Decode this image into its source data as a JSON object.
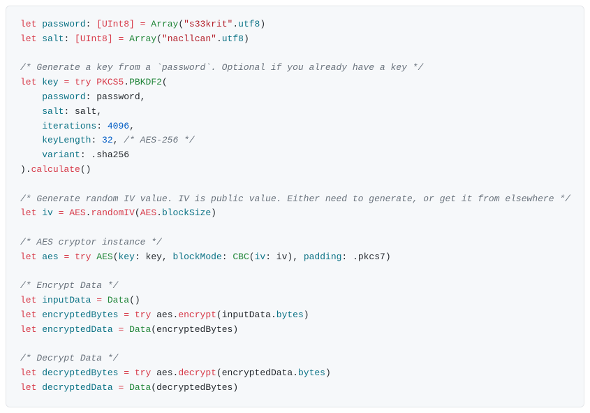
{
  "code": {
    "l1_let": "let",
    "l1_password": "password",
    "l1_type": "[UInt8]",
    "l1_array": "Array",
    "l1_str": "\"s33krit\"",
    "l1_utf8": "utf8",
    "l2_let": "let",
    "l2_salt": "salt",
    "l2_type": "[UInt8]",
    "l2_array": "Array",
    "l2_str": "\"nacllcan\"",
    "l2_utf8": "utf8",
    "c1": "/* Generate a key from a `password`. Optional if you already have a key */",
    "l3_let": "let",
    "l3_key": "key",
    "l3_try": "try",
    "l3_pkcs5": "PKCS5",
    "l3_pbkdf2": "PBKDF2",
    "l4_password_lbl": "password",
    "l4_password_val": "password",
    "l5_salt_lbl": "salt",
    "l5_salt_val": "salt",
    "l6_iter_lbl": "iterations",
    "l6_iter_val": "4096",
    "l7_keylen_lbl": "keyLength",
    "l7_keylen_val": "32",
    "l7_cm": "/* AES-256 */",
    "l8_variant_lbl": "variant",
    "l8_variant_val": "sha256",
    "l9_calculate": "calculate",
    "c2": "/* Generate random IV value. IV is public value. Either need to generate, or get it from elsewhere */",
    "l10_let": "let",
    "l10_iv": "iv",
    "l10_aes": "AES",
    "l10_randomiv": "randomIV",
    "l10_aes2": "AES",
    "l10_blocksize": "blockSize",
    "c3": "/* AES cryptor instance */",
    "l11_let": "let",
    "l11_aes": "aes",
    "l11_try": "try",
    "l11_AES": "AES",
    "l11_key_lbl": "key",
    "l11_key_val": "key",
    "l11_bm_lbl": "blockMode",
    "l11_cbc": "CBC",
    "l11_iv_lbl": "iv",
    "l11_iv_val": "iv",
    "l11_pad_lbl": "padding",
    "l11_pad_val": "pkcs7",
    "c4": "/* Encrypt Data */",
    "l12_let": "let",
    "l12_inputdata": "inputData",
    "l12_data": "Data",
    "l13_let": "let",
    "l13_encbytes": "encryptedBytes",
    "l13_try": "try",
    "l13_aes": "aes",
    "l13_encrypt": "encrypt",
    "l13_inputdata": "inputData",
    "l13_bytes": "bytes",
    "l14_let": "let",
    "l14_encdata": "encryptedData",
    "l14_data": "Data",
    "l14_encbytes": "encryptedBytes",
    "c5": "/* Decrypt Data */",
    "l15_let": "let",
    "l15_decbytes": "decryptedBytes",
    "l15_try": "try",
    "l15_aes": "aes",
    "l15_decrypt": "decrypt",
    "l15_encdata": "encryptedData",
    "l15_bytes": "bytes",
    "l16_let": "let",
    "l16_decdata": "decryptedData",
    "l16_data": "Data",
    "l16_decbytes": "decryptedBytes"
  }
}
